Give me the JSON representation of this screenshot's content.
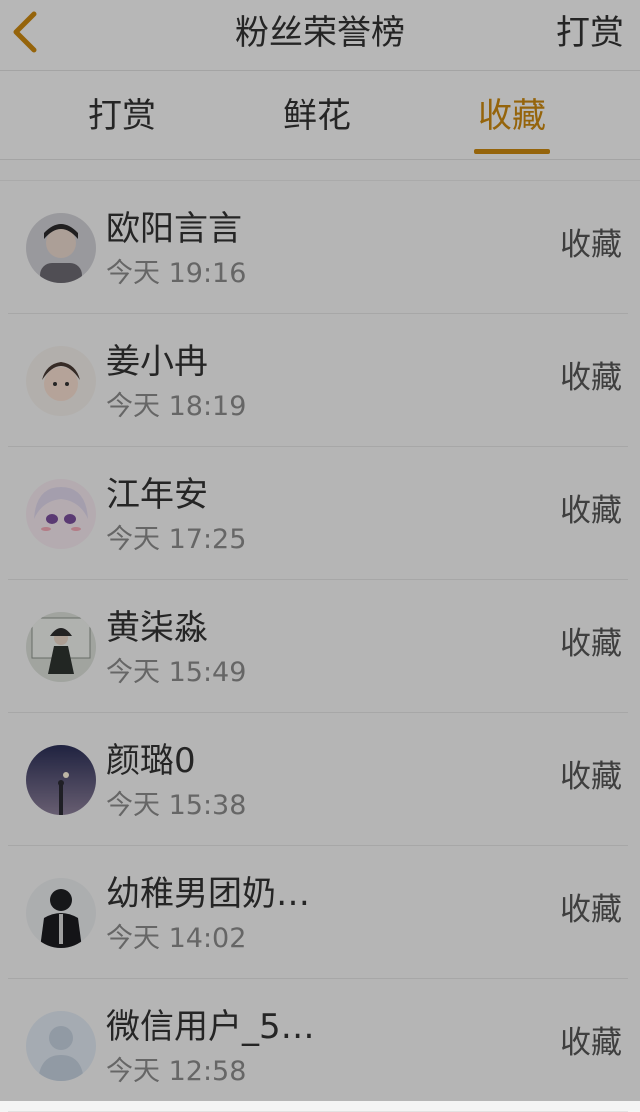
{
  "header": {
    "title": "粉丝荣誉榜",
    "action_label": "打赏",
    "back_icon": "chevron-left-icon",
    "back_color": "#c98710"
  },
  "tabs": [
    {
      "label": "打赏",
      "active": false
    },
    {
      "label": "鲜花",
      "active": false
    },
    {
      "label": "收藏",
      "active": true
    }
  ],
  "accent_color": "#c98710",
  "list": [
    {
      "name": "欧阳言言",
      "time": "今天 19:16",
      "type": "收藏",
      "avatar": "user-photo-avatar"
    },
    {
      "name": "姜小冉",
      "time": "今天 18:19",
      "type": "收藏",
      "avatar": "user-photo-avatar"
    },
    {
      "name": "江年安",
      "time": "今天 17:25",
      "type": "收藏",
      "avatar": "anime-avatar"
    },
    {
      "name": "黄柒淼",
      "time": "今天 15:49",
      "type": "收藏",
      "avatar": "user-photo-avatar"
    },
    {
      "name": "颜璐0",
      "time": "今天 15:38",
      "type": "收藏",
      "avatar": "night-sky-avatar"
    },
    {
      "name": "幼稚男团奶…",
      "time": "今天 14:02",
      "type": "收藏",
      "avatar": "user-photo-avatar"
    },
    {
      "name": "微信用户_5…",
      "time": "今天 12:58",
      "type": "收藏",
      "avatar": "default-user-avatar"
    }
  ]
}
